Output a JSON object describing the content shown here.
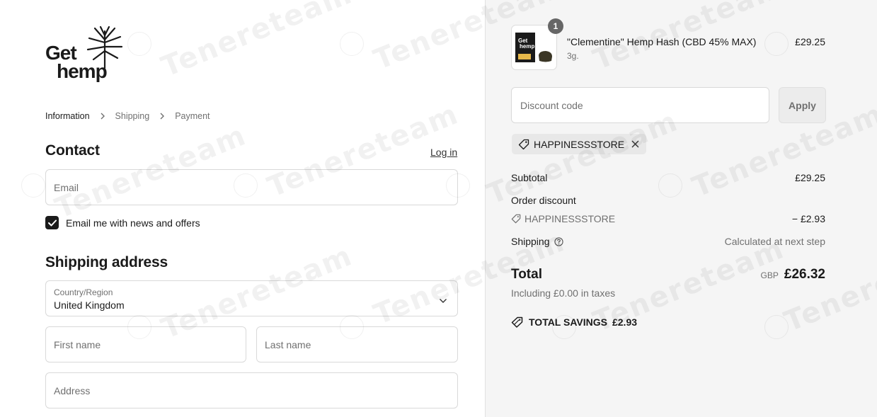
{
  "brand": {
    "line1": "Get",
    "line2": "hemp"
  },
  "breadcrumb": {
    "items": [
      "Information",
      "Shipping",
      "Payment"
    ]
  },
  "contact": {
    "title": "Contact",
    "login_link": "Log in",
    "email_placeholder": "Email",
    "newsletter_label": "Email me with news and offers",
    "newsletter_checked": true
  },
  "shipping": {
    "title": "Shipping address",
    "country_label": "Country/Region",
    "country_value": "United Kingdom",
    "first_name_placeholder": "First name",
    "last_name_placeholder": "Last name",
    "address_placeholder": "Address"
  },
  "order": {
    "item": {
      "quantity": "1",
      "name": "\"Clementine\" Hemp Hash (CBD 45% MAX)",
      "variant": "3g.",
      "price": "£29.25"
    },
    "discount_placeholder": "Discount code",
    "apply_label": "Apply",
    "applied_code": "HAPPINESSSTORE",
    "subtotal_label": "Subtotal",
    "subtotal_value": "£29.25",
    "order_discount_label": "Order discount",
    "discount_code": "HAPPINESSSTORE",
    "discount_value": "− £2.93",
    "shipping_label": "Shipping",
    "shipping_value": "Calculated at next step",
    "total_label": "Total",
    "currency": "GBP",
    "total_value": "£26.32",
    "taxes_text": "Including £0.00 in taxes",
    "savings_label": "TOTAL SAVINGS",
    "savings_value": "£2.93"
  },
  "watermark": "Tenereteam",
  "icons": [
    "hemp-leaf-icon",
    "chevron-right-icon",
    "check-icon",
    "chevron-down-icon",
    "tag-icon",
    "close-icon",
    "help-circle-icon",
    "savings-tag-icon"
  ]
}
